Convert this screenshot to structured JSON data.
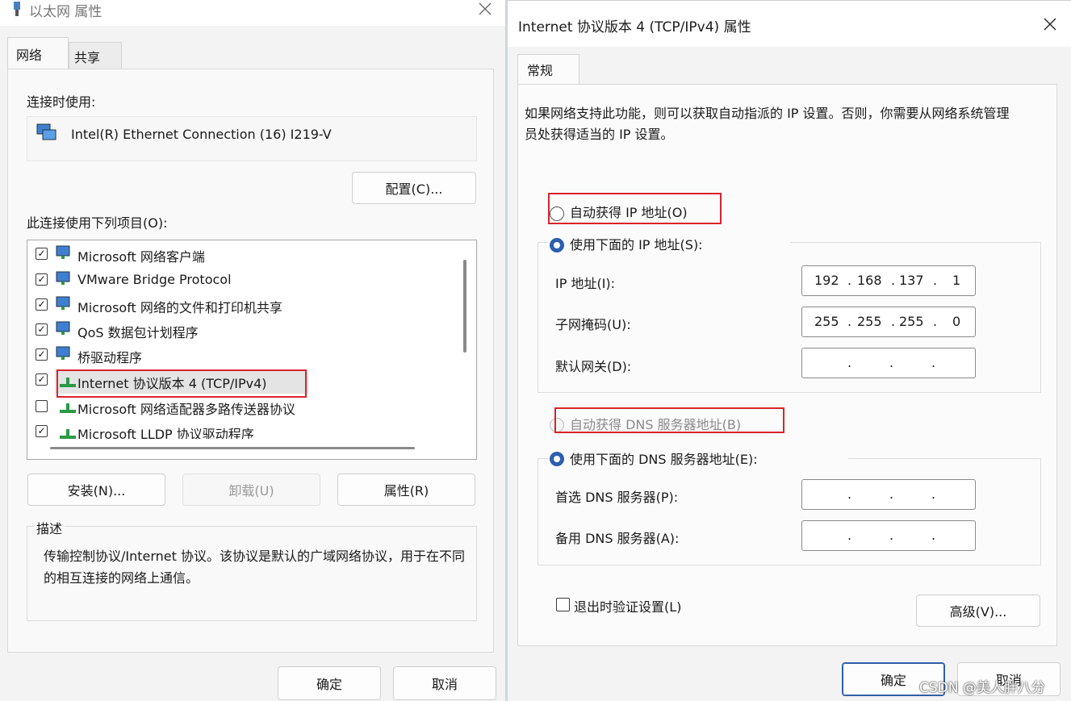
{
  "left_window": {
    "title": "以太网 属性",
    "tabs": [
      "网络",
      "共享"
    ],
    "connect_using_label": "连接时使用:",
    "adapter_name": "Intel(R) Ethernet Connection (16) I219-V",
    "configure_button": "配置(C)...",
    "items_label": "此连接使用下列项目(O):",
    "items": [
      {
        "label": "Microsoft 网络客户端",
        "checked": true
      },
      {
        "label": "VMware Bridge Protocol",
        "checked": true
      },
      {
        "label": "Microsoft 网络的文件和打印机共享",
        "checked": true
      },
      {
        "label": "QoS 数据包计划程序",
        "checked": true
      },
      {
        "label": "桥驱动程序",
        "checked": true
      },
      {
        "label": "Internet 协议版本 4 (TCP/IPv4)",
        "checked": true
      },
      {
        "label": "Microsoft 网络适配器多路传送器协议",
        "checked": false
      },
      {
        "label": "Microsoft LLDP 协议驱动程序",
        "checked": true
      }
    ],
    "install_button": "安装(N)...",
    "uninstall_button": "卸载(U)",
    "properties_button": "属性(R)",
    "description_title": "描述",
    "description_text": "传输控制协议/Internet 协议。该协议是默认的广域网络协议，用于在不同的相互连接的网络上通信。",
    "ok_button": "确定",
    "cancel_button": "取消"
  },
  "right_window": {
    "title": "Internet 协议版本 4 (TCP/IPv4) 属性",
    "tab": "常规",
    "intro_text": "如果网络支持此功能，则可以获取自动指派的 IP 设置。否则，你需要从网络系统管理员处获得适当的 IP 设置。",
    "auto_ip_label": "自动获得 IP 地址(O)",
    "manual_ip_label": "使用下面的 IP 地址(S):",
    "ip_address_label": "IP 地址(I):",
    "ip_address": [
      "192",
      "168",
      "137",
      "1"
    ],
    "subnet_label": "子网掩码(U):",
    "subnet": [
      "255",
      "255",
      "255",
      "0"
    ],
    "gateway_label": "默认网关(D):",
    "auto_dns_label": "自动获得 DNS 服务器地址(B)",
    "manual_dns_label": "使用下面的 DNS 服务器地址(E):",
    "preferred_dns_label": "首选 DNS 服务器(P):",
    "alternate_dns_label": "备用 DNS 服务器(A):",
    "validate_label": "退出时验证设置(L)",
    "advanced_button": "高级(V)...",
    "ok_button": "确定",
    "cancel_button": "取消"
  },
  "watermark": "CSDN @美人胖八分",
  "icons": {
    "close": "close-icon",
    "network": "network-adapter-icon",
    "protocol": "protocol-icon"
  },
  "colors": {
    "accent": "#2d5fb0",
    "highlight": "#d9232d",
    "background": "#f0f0f0"
  }
}
